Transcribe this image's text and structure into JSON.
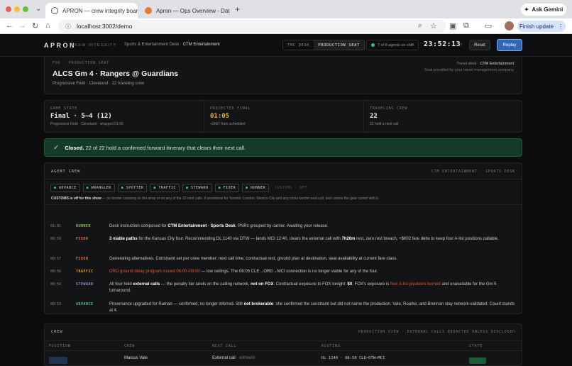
{
  "browser": {
    "tabs": [
      {
        "title": "APRON — crew integrity boar",
        "active": true
      },
      {
        "title": "Apron — Ops Overview - Dat",
        "active": false
      }
    ],
    "url": "localhost:3002/demo",
    "gemini": "Ask Gemini",
    "finish": "Finish update"
  },
  "header": {
    "logo": "APRON",
    "logo_sub": "CREW INTEGRITY",
    "desk_prefix": "Sports & Entertainment Desk · ",
    "desk_name": "CTM Entertainment",
    "modes": [
      "TMC DESK",
      "PRODUCTION SEAT"
    ],
    "shift": "7 of 8 agents on shift",
    "clock": "23:52:13",
    "tz": "ET",
    "reset": "Reset",
    "replay": "Replay"
  },
  "event": {
    "eyebrow": "FOX · PRODUCTION SEAT",
    "title": "ALCS Gm 4 · Rangers @ Guardians",
    "subtitle": "Progressive Field · Cleveland · 22 traveling crew",
    "travel_desk_prefix": "Travel desk · ",
    "travel_desk": "CTM Entertainment",
    "seat_note": "Seat provided by your travel management company"
  },
  "stats": [
    {
      "label": "GAME STATE",
      "value": "Final · 5–4 (12)",
      "sub": "Progressive Field · Cleveland · wrapped 01:05",
      "color": "#f0f0f0"
    },
    {
      "label": "PROJECTED FINAL",
      "value": "01:05",
      "sub": "+2h07 from scheduled",
      "color": "#e6b33a"
    },
    {
      "label": "TRAVELING CREW",
      "value": "22",
      "sub": "22 hold a next call",
      "color": "#f0f0f0"
    }
  ],
  "banner": {
    "strong": "Closed.",
    "text": " 22 of 22 hold a confirmed forward itinerary that clears their next call."
  },
  "agents": {
    "title": "AGENT CREW",
    "right": "CTM ENTERTAINMENT · SPORTS DESK",
    "chips": [
      "ADVANCE",
      "WRANGLER",
      "SPOTTER",
      "TRAFFIC",
      "STEWARD",
      "FIXER",
      "RUNNER"
    ],
    "customs_chip": "CUSTOMS · OFF",
    "customs_note_strong": "CUSTOMS is off for this show",
    "customs_note": " — no border crossing on the wrap or on any of the 22 next calls. It provisions for Toronto, London, Mexico City and any cross-border next call, and carries the gear carnet with it."
  },
  "log": [
    {
      "time": "01:01",
      "agent": "RUNNER",
      "color": "#8fbf55",
      "parts": [
        [
          "Desk instruction composed for ",
          ""
        ],
        [
          "CTM Entertainment · Sports Desk",
          "w"
        ],
        [
          ". PNRs grouped by carrier. Awaiting your release.",
          ""
        ]
      ]
    },
    {
      "time": "00:59",
      "agent": "FIXER",
      "color": "#e57a3c",
      "parts": [
        [
          "3 viable paths",
          "w"
        ],
        [
          " for the Kansas City four. Recommending DL 1140 via DTW — lands MCI 12:40, clears the external call with ",
          ""
        ],
        [
          "7h20m",
          "w"
        ],
        [
          " rest, zero rest breach, +$602 fare delta to keep four A-list positions callable.",
          ""
        ]
      ]
    },
    {
      "time": "00:57",
      "agent": "FIXER",
      "color": "#e57a3c",
      "parts": [
        [
          "Generating alternatives. Constraint set per crew member: next call time, contractual rest, ground plan at destination, seat availability at current fare class.",
          ""
        ]
      ]
    },
    {
      "time": "00:56",
      "agent": "TRAFFIC",
      "color": "#e5a53c",
      "parts": [
        [
          "ORD ground delay program issued 06:00–09:00",
          "red"
        ],
        [
          " — low ceilings. The 06:05 CLE→ORD→MCI connection is no longer viable for any of the four.",
          ""
        ]
      ]
    },
    {
      "time": "00:54",
      "agent": "STEWARD",
      "color": "#9a8fe5",
      "parts": [
        [
          "All four hold ",
          ""
        ],
        [
          "external calls",
          "w"
        ],
        [
          " — the penalty tier lands on the calling network, ",
          ""
        ],
        [
          "not on FOX",
          "w"
        ],
        [
          ". Contractual exposure to FOX tonight: ",
          ""
        ],
        [
          "$0",
          "w"
        ],
        [
          ". FOX's exposure is ",
          ""
        ],
        [
          "four A-list positions burned",
          "red"
        ],
        [
          " and unavailable for the Gm 5 turnaround.",
          ""
        ]
      ]
    },
    {
      "time": "00:53",
      "agent": "ADVANCE",
      "color": "#4fc08d",
      "parts": [
        [
          "Provenance upgraded for Raman — confirmed, no longer inferred. Still ",
          ""
        ],
        [
          "not brokerable",
          "w"
        ],
        [
          ": she confirmed the constraint but did not name the production. Vale, Roarke, and Brennan stay network-validated. Count stands at 4.",
          ""
        ]
      ]
    }
  ],
  "crew": {
    "title": "CREW",
    "right": "PRODUCTION VIEW · EXTERNAL CALLS REDACTED UNLESS DISCLOSED",
    "columns": [
      "POSITION",
      "CREW",
      "NEXT CALL",
      "ROUTING",
      "STATE"
    ],
    "rows": [
      {
        "crew": "Marcus Vale",
        "next": "External call",
        "next_note": " · withheld",
        "routing": "DL 1140 · 08:50 CLE→DTW→MCI"
      }
    ]
  }
}
